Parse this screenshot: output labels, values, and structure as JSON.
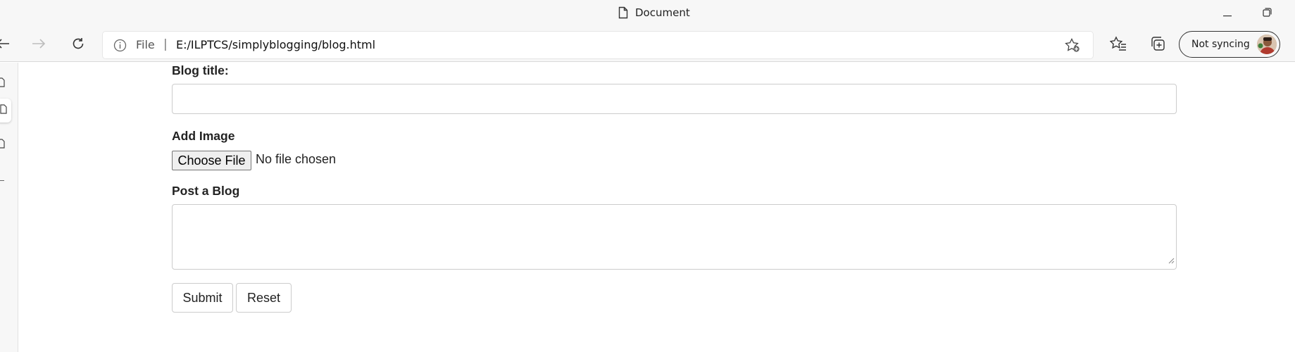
{
  "window": {
    "title": "Document"
  },
  "toolbar": {
    "address_prefix": "File",
    "address_separator": "|",
    "url": "E:/ILPTCS/simplyblogging/blog.html",
    "profile_label": "Not syncing"
  },
  "form": {
    "blog_title_label": "Blog title:",
    "add_image_label": "Add Image",
    "choose_file_label": "Choose File",
    "file_status": "No file chosen",
    "post_label": "Post a Blog",
    "submit_label": "Submit",
    "reset_label": "Reset"
  },
  "colors": {
    "chrome_bg": "#f7f7f7",
    "page_bg": "#ffffff",
    "input_border": "#cccccc",
    "text": "#222222"
  },
  "icons": {
    "title": "document-icon",
    "minimize": "minimize-icon",
    "restore": "restore-icon",
    "back": "back-arrow-icon",
    "forward": "forward-arrow-icon",
    "refresh": "refresh-icon",
    "info": "info-icon",
    "add_favorite": "star-plus-icon",
    "favorites": "favorites-icon",
    "collections": "collections-icon",
    "sidebar": [
      "tab-icon",
      "tab-icon",
      "tab-icon"
    ]
  }
}
